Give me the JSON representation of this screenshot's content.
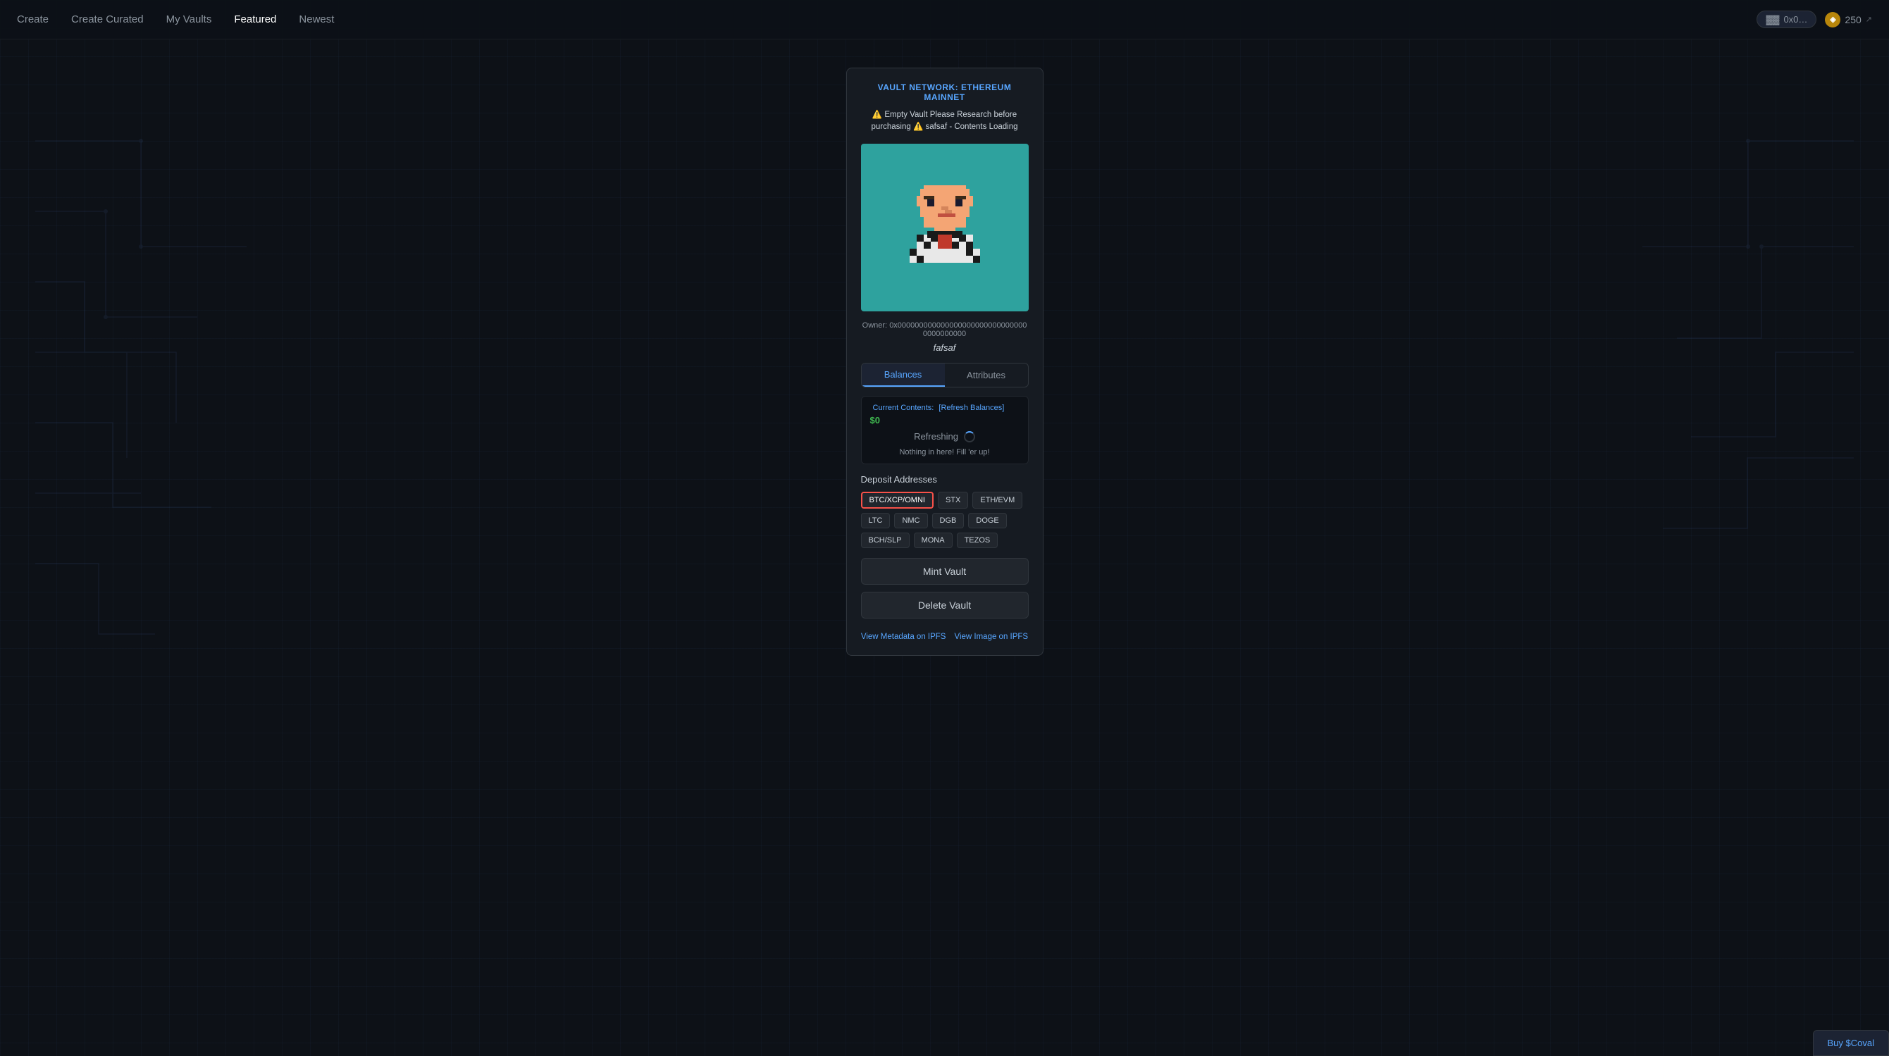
{
  "nav": {
    "items": [
      {
        "id": "create",
        "label": "Create",
        "active": false
      },
      {
        "id": "create-curated",
        "label": "Create Curated",
        "active": false
      },
      {
        "id": "my-vaults",
        "label": "My Vaults",
        "active": false
      },
      {
        "id": "featured",
        "label": "Featured",
        "active": true
      },
      {
        "id": "newest",
        "label": "Newest",
        "active": false
      }
    ],
    "balance": "250",
    "balance_label": "250"
  },
  "vault": {
    "network_label": "VAULT NETWORK: ETHEREUM MAINNET",
    "warning_text": "⚠️ Empty Vault Please Research before purchasing ⚠️ safsaf - Contents Loading",
    "owner_label": "Owner:",
    "owner_address": "0x0000000000000000000000000000000000000000",
    "vault_name": "fafsaf",
    "image_bg": "#2ea29e",
    "tabs": [
      {
        "id": "balances",
        "label": "Balances",
        "active": true
      },
      {
        "id": "attributes",
        "label": "Attributes",
        "active": false
      }
    ],
    "balances": {
      "current_contents_label": "Current Contents:",
      "refresh_label": "[Refresh Balances]",
      "value": "$0",
      "refreshing_label": "Refreshing",
      "empty_msg": "Nothing in here! Fill 'er up!"
    },
    "deposit": {
      "section_label": "Deposit Addresses",
      "buttons": [
        {
          "id": "btc-xcp-omni",
          "label": "BTC/XCP/OMNI",
          "selected": true
        },
        {
          "id": "stx",
          "label": "STX",
          "selected": false
        },
        {
          "id": "eth-evm",
          "label": "ETH/EVM",
          "selected": false
        },
        {
          "id": "ltc",
          "label": "LTC",
          "selected": false
        },
        {
          "id": "nmc",
          "label": "NMC",
          "selected": false
        },
        {
          "id": "dgb",
          "label": "DGB",
          "selected": false
        },
        {
          "id": "doge",
          "label": "DOGE",
          "selected": false
        },
        {
          "id": "bch-slp",
          "label": "BCH/SLP",
          "selected": false
        },
        {
          "id": "mona",
          "label": "MONA",
          "selected": false
        },
        {
          "id": "tezos",
          "label": "TEZOS",
          "selected": false
        }
      ]
    },
    "mint_vault_label": "Mint Vault",
    "delete_vault_label": "Delete Vault",
    "footer": {
      "ipfs_metadata_label": "View Metadata on IPFS",
      "ipfs_image_label": "View Image on IPFS"
    }
  },
  "buy_coval_label": "Buy $Coval"
}
